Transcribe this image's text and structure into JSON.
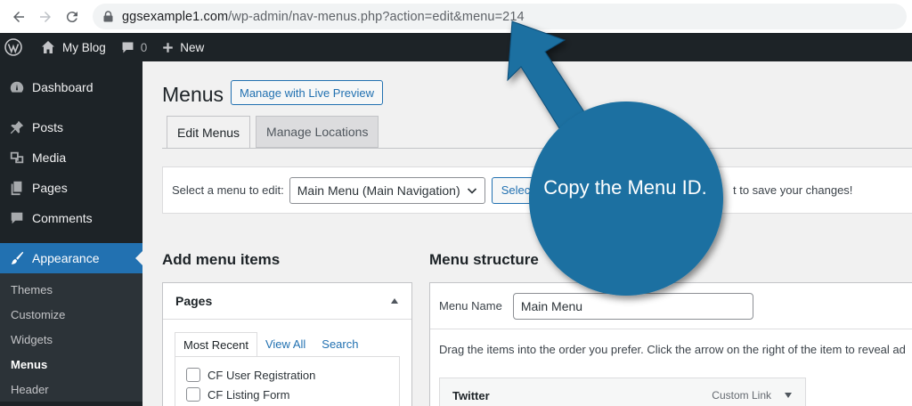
{
  "browser": {
    "url_host": "ggsexample1.com",
    "url_path": "/wp-admin/nav-menus.php?action=edit&menu=214"
  },
  "adminbar": {
    "site_name": "My Blog",
    "comments_count": "0",
    "new_label": "New"
  },
  "sidebar": {
    "items": [
      {
        "label": "Dashboard",
        "icon": "dashboard-icon"
      },
      {
        "label": "Posts",
        "icon": "pin-icon"
      },
      {
        "label": "Media",
        "icon": "media-icon"
      },
      {
        "label": "Pages",
        "icon": "pages-icon"
      },
      {
        "label": "Comments",
        "icon": "comment-icon"
      },
      {
        "label": "Appearance",
        "icon": "brush-icon"
      }
    ],
    "submenu": [
      "Themes",
      "Customize",
      "Widgets",
      "Menus",
      "Header"
    ]
  },
  "main": {
    "title": "Menus",
    "live_preview_label": "Manage with Live Preview",
    "tabs": [
      "Edit Menus",
      "Manage Locations"
    ],
    "select_label": "Select a menu to edit:",
    "select_value": "Main Menu (Main Navigation)",
    "select_button": "Select",
    "save_hint": "t to save your changes!",
    "add_items_heading": "Add menu items",
    "structure_heading": "Menu structure",
    "pages_box_title": "Pages",
    "pages_tabs": [
      "Most Recent",
      "View All",
      "Search"
    ],
    "pages_items": [
      "CF User Registration",
      "CF Listing Form"
    ],
    "menu_name_label": "Menu Name",
    "menu_name_value": "Main Menu",
    "drag_text": "Drag the items into the order you prefer. Click the arrow on the right of the item to reveal ad",
    "menu_item": {
      "title": "Twitter",
      "type": "Custom Link"
    }
  },
  "callout": {
    "text": "Copy the Menu ID.",
    "color": "#1a6fa1"
  }
}
